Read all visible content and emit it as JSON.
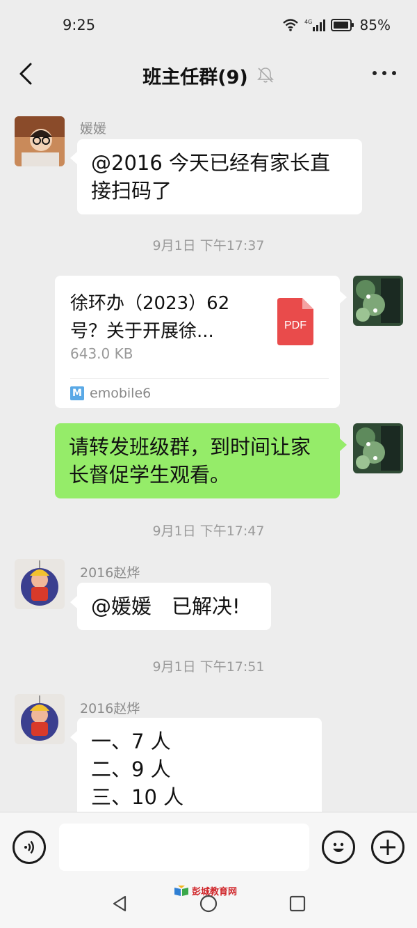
{
  "status_bar": {
    "time": "9:25",
    "network": "4G",
    "battery": "85%"
  },
  "header": {
    "title": "班主任群(9)"
  },
  "messages": [
    {
      "sender": "媛媛",
      "text_line1": "@2016  今天已经有家长直",
      "text_line2": "接扫码了"
    },
    {
      "timestamp": "9月1日 下午17:37"
    },
    {
      "file": {
        "name_line1": "徐环办（2023）62",
        "name_line2": "号？关于开展徐...",
        "size": "643.0 KB",
        "type_label": "PDF",
        "source": "emobile6",
        "source_logo": "M"
      }
    },
    {
      "text_line1": "请转发班级群，到时间让家",
      "text_line2": "长督促学生观看。"
    },
    {
      "timestamp": "9月1日 下午17:47"
    },
    {
      "sender": "2016赵烨",
      "text": "@媛媛　已解决!"
    },
    {
      "timestamp": "9月1日 下午17:51"
    },
    {
      "sender": "2016赵烨",
      "lines": [
        "一、7 人",
        "二、9 人",
        "三、10 人"
      ]
    }
  ],
  "watermark": "彭城教育网",
  "colors": {
    "background": "#ededed",
    "sent_bubble": "#95ec69",
    "received_bubble": "#ffffff",
    "pdf_red": "#e94b4b"
  },
  "icons": [
    "back-arrow-icon",
    "mute-bell-icon",
    "more-icon",
    "voice-icon",
    "emoji-icon",
    "add-icon",
    "pdf-icon"
  ]
}
